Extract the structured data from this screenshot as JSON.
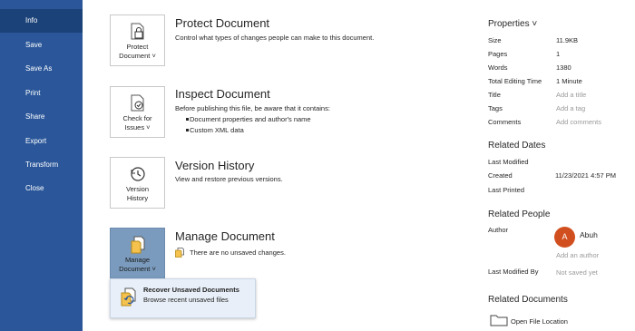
{
  "nav": {
    "items": [
      {
        "label": "Info"
      },
      {
        "label": "Save"
      },
      {
        "label": "Save As"
      },
      {
        "label": "Print"
      },
      {
        "label": "Share"
      },
      {
        "label": "Export"
      },
      {
        "label": "Transform"
      },
      {
        "label": "Close"
      }
    ]
  },
  "protect": {
    "button_line1": "Protect",
    "button_line2": "Document ˅",
    "title": "Protect Document",
    "desc": "Control what types of changes people can make to this document."
  },
  "inspect": {
    "button_line1": "Check for",
    "button_line2": "Issues ˅",
    "title": "Inspect Document",
    "desc": "Before publishing this file, be aware that it contains:",
    "bullets": [
      "Document properties and author's name",
      "Custom XML data"
    ]
  },
  "version": {
    "button_line1": "Version",
    "button_line2": "History",
    "title": "Version History",
    "desc": "View and restore previous versions."
  },
  "manage": {
    "button_line1": "Manage",
    "button_line2": "Document ˅",
    "title": "Manage Document",
    "desc": "There are no unsaved changes.",
    "menu": {
      "title": "Recover Unsaved Documents",
      "desc": "Browse recent unsaved files"
    }
  },
  "properties": {
    "heading": "Properties ˅",
    "rows": [
      {
        "key": "Size",
        "value": "11.9KB"
      },
      {
        "key": "Pages",
        "value": "1"
      },
      {
        "key": "Words",
        "value": "1380"
      },
      {
        "key": "Total Editing Time",
        "value": "1 Minute"
      },
      {
        "key": "Title",
        "value": "Add a title"
      },
      {
        "key": "Tags",
        "value": "Add a tag"
      },
      {
        "key": "Comments",
        "value": "Add comments"
      }
    ]
  },
  "related_dates": {
    "heading": "Related Dates",
    "last_modified": "Last Modified",
    "created": "Created",
    "created_value": "11/23/2021 4:57 PM",
    "last_printed": "Last Printed"
  },
  "related_people": {
    "heading": "Related People",
    "author_label": "Author",
    "avatar_initial": "A",
    "author_name": "Abuh",
    "add_author": "Add an author",
    "last_modified_by": "Last Modified By",
    "not_saved": "Not saved yet"
  },
  "related_docs": {
    "heading": "Related Documents",
    "open_location": "Open File Location"
  },
  "colors": {
    "sidebar": "#2b579a",
    "sidebar_active": "#1b4279",
    "avatar": "#d14f1e",
    "selected_card": "#7a9bbd"
  }
}
